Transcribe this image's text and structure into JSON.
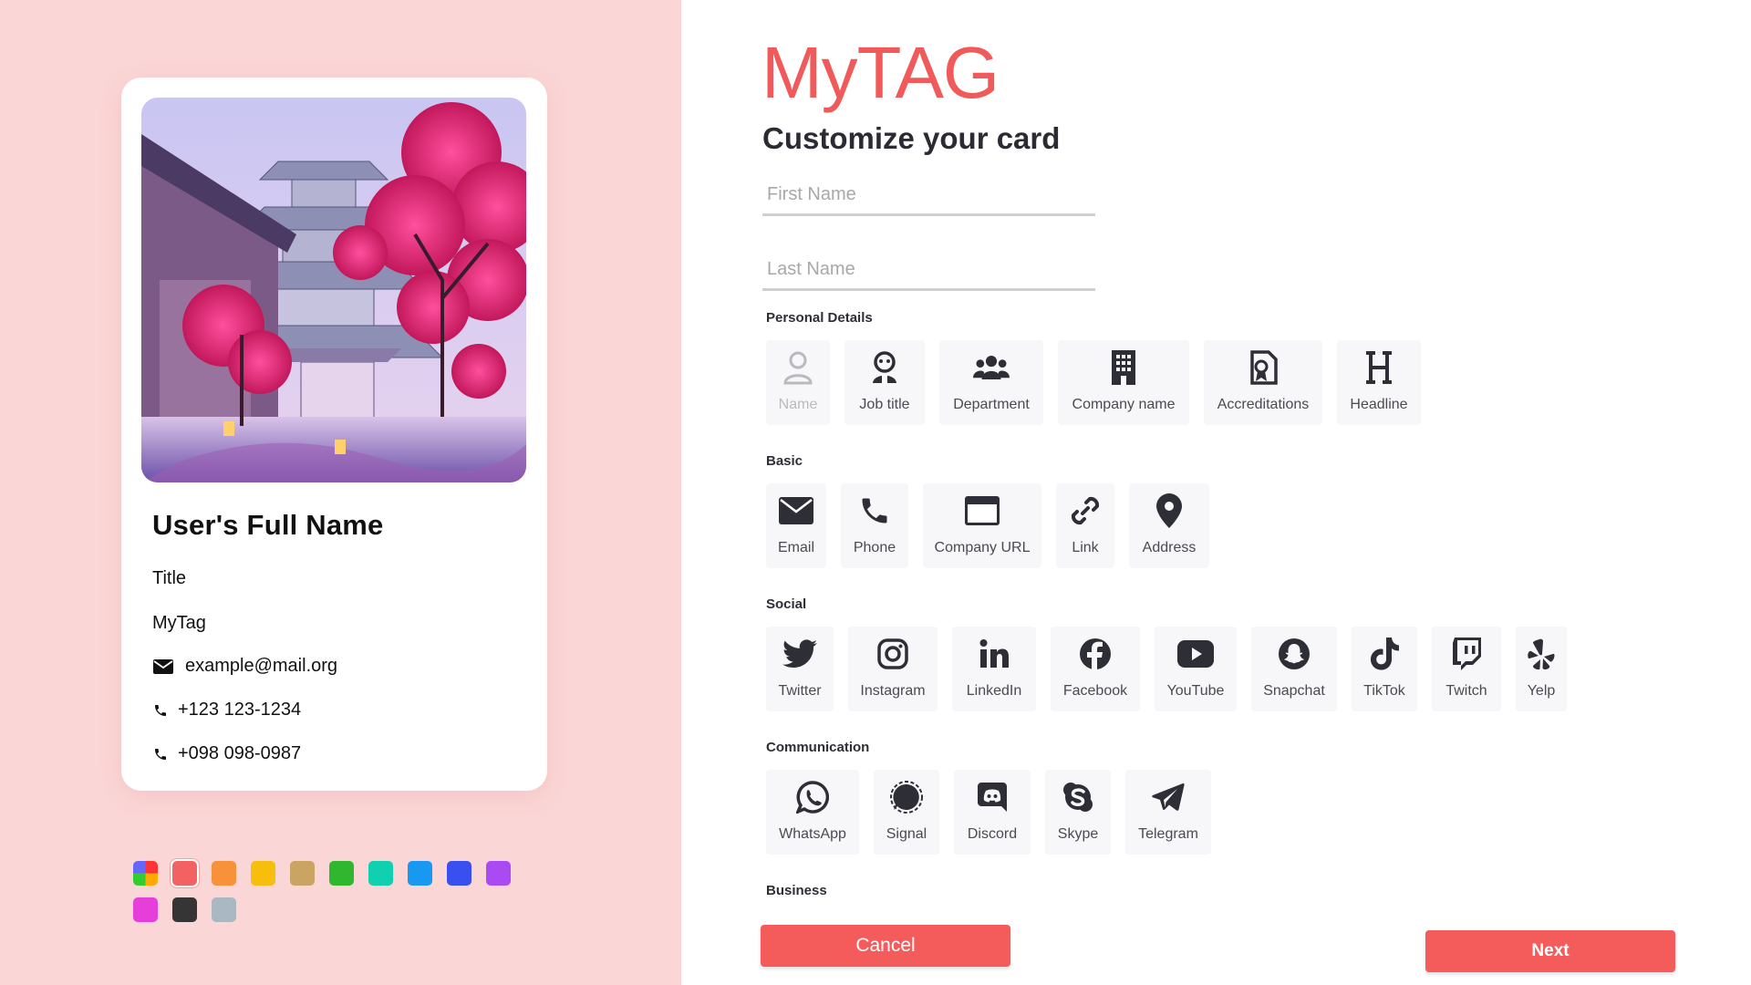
{
  "app": {
    "brand": "MyTAG",
    "subtitle": "Customize your card"
  },
  "colors": {
    "accent": "#f45c5c",
    "left_bg": "#fbd6d6"
  },
  "card": {
    "name": "User's Full Name",
    "title": "Title",
    "company": "MyTag",
    "email": "example@mail.org",
    "phone_1": "+123 123-1234",
    "phone_2": "+098 098-0987"
  },
  "swatches": [
    "multicolor",
    "#f36262",
    "#f7913a",
    "#f8be0d",
    "#c9a463",
    "#2fb72f",
    "#0fd1b0",
    "#1998f2",
    "#3a4fef",
    "#a94af2",
    "#e83ed9",
    "#353535",
    "#a9b8c2"
  ],
  "form": {
    "first_name_placeholder": "First Name",
    "last_name_placeholder": "Last Name"
  },
  "sections": {
    "personal": {
      "label": "Personal Details",
      "items": [
        {
          "label": "Name",
          "icon": "user-icon"
        },
        {
          "label": "Job title",
          "icon": "badge-icon"
        },
        {
          "label": "Department",
          "icon": "group-icon"
        },
        {
          "label": "Company name",
          "icon": "building-icon"
        },
        {
          "label": "Accreditations",
          "icon": "certificate-icon"
        },
        {
          "label": "Headline",
          "icon": "heading-icon"
        }
      ]
    },
    "basic": {
      "label": "Basic",
      "items": [
        {
          "label": "Email",
          "icon": "envelope-icon"
        },
        {
          "label": "Phone",
          "icon": "phone-icon"
        },
        {
          "label": "Company URL",
          "icon": "browser-icon"
        },
        {
          "label": "Link",
          "icon": "link-icon"
        },
        {
          "label": "Address",
          "icon": "map-pin-icon"
        }
      ]
    },
    "social": {
      "label": "Social",
      "items": [
        {
          "label": "Twitter",
          "icon": "twitter-icon"
        },
        {
          "label": "Instagram",
          "icon": "instagram-icon"
        },
        {
          "label": "LinkedIn",
          "icon": "linkedin-icon"
        },
        {
          "label": "Facebook",
          "icon": "facebook-icon"
        },
        {
          "label": "YouTube",
          "icon": "youtube-icon"
        },
        {
          "label": "Snapchat",
          "icon": "snapchat-icon"
        },
        {
          "label": "TikTok",
          "icon": "tiktok-icon"
        },
        {
          "label": "Twitch",
          "icon": "twitch-icon"
        },
        {
          "label": "Yelp",
          "icon": "yelp-icon"
        }
      ]
    },
    "communication": {
      "label": "Communication",
      "items": [
        {
          "label": "WhatsApp",
          "icon": "whatsapp-icon"
        },
        {
          "label": "Signal",
          "icon": "signal-icon"
        },
        {
          "label": "Discord",
          "icon": "discord-icon"
        },
        {
          "label": "Skype",
          "icon": "skype-icon"
        },
        {
          "label": "Telegram",
          "icon": "telegram-icon"
        }
      ]
    },
    "business": {
      "label": "Business"
    }
  },
  "buttons": {
    "cancel": "Cancel",
    "next": "Next"
  }
}
